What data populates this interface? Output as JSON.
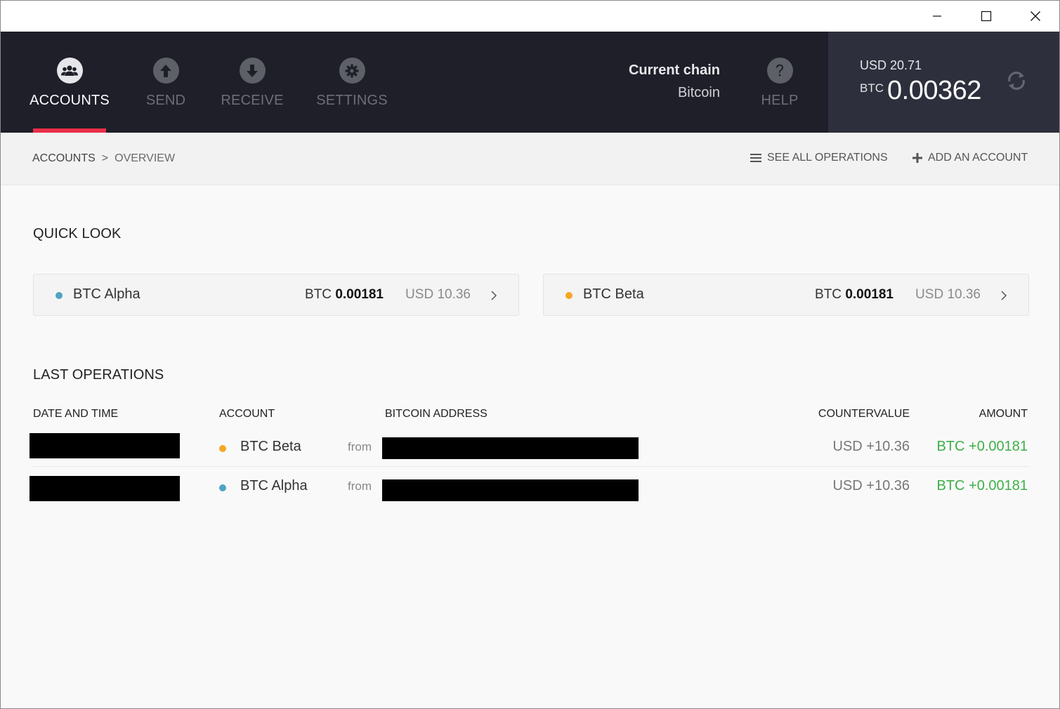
{
  "window": {
    "minimize_icon": "minimize-icon",
    "maximize_icon": "maximize-icon",
    "close_icon": "close-icon"
  },
  "nav": {
    "items": [
      {
        "label": "ACCOUNTS",
        "icon": "users-icon",
        "active": true
      },
      {
        "label": "SEND",
        "icon": "arrow-up-icon",
        "active": false
      },
      {
        "label": "RECEIVE",
        "icon": "arrow-down-icon",
        "active": false
      },
      {
        "label": "SETTINGS",
        "icon": "gear-icon",
        "active": false
      }
    ],
    "chain_title": "Current chain",
    "chain_value": "Bitcoin",
    "help_label": "HELP"
  },
  "balance": {
    "usd": "USD 20.71",
    "btc_unit": "BTC",
    "btc_value": "0.00362",
    "refresh_icon": "refresh-icon"
  },
  "breadcrumb": {
    "root": "ACCOUNTS",
    "separator": ">",
    "current": "OVERVIEW"
  },
  "actions": {
    "see_all": "SEE ALL OPERATIONS",
    "add_account": "ADD AN ACCOUNT"
  },
  "quick_look": {
    "title": "QUICK LOOK",
    "cards": [
      {
        "name": "BTC Alpha",
        "btc_unit": "BTC",
        "btc_value": "0.00181",
        "usd": "USD 10.36",
        "color": "#4fa3c4"
      },
      {
        "name": "BTC Beta",
        "btc_unit": "BTC",
        "btc_value": "0.00181",
        "usd": "USD 10.36",
        "color": "#f5a623"
      }
    ]
  },
  "last_operations": {
    "title": "LAST OPERATIONS",
    "headers": {
      "date": "DATE AND TIME",
      "account": "ACCOUNT",
      "address": "BITCOIN ADDRESS",
      "countervalue": "COUNTERVALUE",
      "amount": "AMOUNT"
    },
    "rows": [
      {
        "account": "BTC Beta",
        "from": "from",
        "countervalue": "USD +10.36",
        "amount": "BTC +0.00181",
        "color": "#f5a623"
      },
      {
        "account": "BTC Alpha",
        "from": "from",
        "countervalue": "USD +10.36",
        "amount": "BTC +0.00181",
        "color": "#4fa3c4"
      }
    ]
  },
  "colors": {
    "nav_bg": "#1e1f29",
    "balance_bg": "#2d303c",
    "active_underline": "#ea2e49",
    "amount_green": "#3fae49"
  }
}
